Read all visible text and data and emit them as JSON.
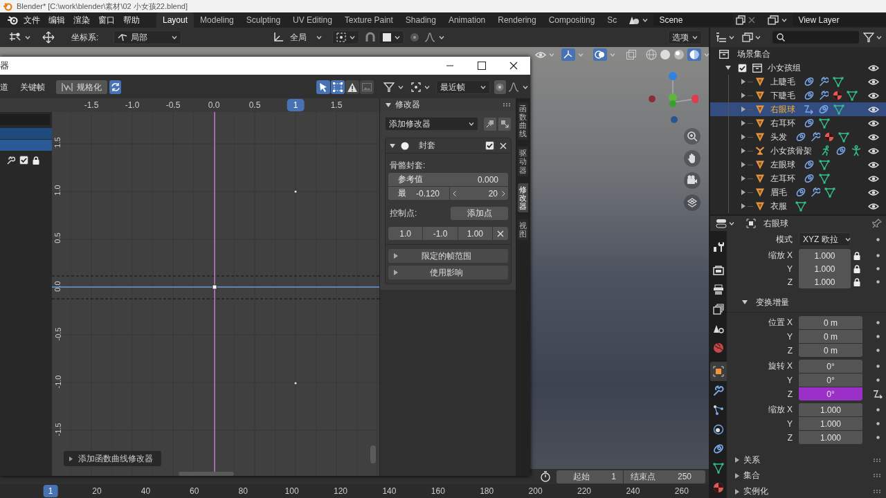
{
  "title_bar": {
    "title": "Blender* [C:\\work\\blender\\素材\\02 小女孩22.blend]"
  },
  "menu": [
    "文件",
    "编辑",
    "渲染",
    "窗口",
    "帮助"
  ],
  "workspaces": [
    {
      "label": "Layout",
      "selected": true
    },
    {
      "label": "Modeling",
      "selected": false
    },
    {
      "label": "Sculpting",
      "selected": false
    },
    {
      "label": "UV Editing",
      "selected": false
    },
    {
      "label": "Texture Paint",
      "selected": false
    },
    {
      "label": "Shading",
      "selected": false
    },
    {
      "label": "Animation",
      "selected": false
    },
    {
      "label": "Rendering",
      "selected": false
    },
    {
      "label": "Compositing",
      "selected": false
    },
    {
      "label": "Sc",
      "selected": false
    }
  ],
  "scene": "Scene",
  "view_layer": "View Layer",
  "viewport_header": {
    "coordinate_label": "坐标系:",
    "orientation": "局部",
    "pivot_space": "全局",
    "options": "选项"
  },
  "graph_editor": {
    "title": "器",
    "menus": [
      "道",
      "关键帧"
    ],
    "normalize": {
      "label": "规格化",
      "on": false
    },
    "auto_normalize": {
      "on": true
    },
    "filters": [
      {
        "kind": "select",
        "on": true
      },
      {
        "kind": "box",
        "on": true
      },
      {
        "kind": "warning",
        "on": false
      },
      {
        "kind": "image",
        "on": false
      }
    ],
    "snap": "最近帧",
    "channel_toggle": {
      "checked": true
    },
    "x_ticks": [
      {
        "label": "-1.5",
        "selected": false
      },
      {
        "label": "-1.0",
        "selected": false
      },
      {
        "label": "-0.5",
        "selected": false
      },
      {
        "label": "0.0",
        "selected": false
      },
      {
        "label": "0.5",
        "selected": false
      },
      {
        "label": "1",
        "selected": true
      },
      {
        "label": "1.5",
        "selected": false
      }
    ],
    "y_ticks": [
      "1.5",
      "1.0",
      "0.5",
      "0.0",
      "-0.5",
      "-1.0",
      "-1.5"
    ],
    "add_modifier_hint": "添加函数曲线修改器",
    "sidebar": {
      "tabs": [
        {
          "label": "函数曲线",
          "selected": false
        },
        {
          "label": "驱动器",
          "selected": false
        },
        {
          "label": "修改器",
          "selected": true
        },
        {
          "label": "视图",
          "selected": false
        }
      ],
      "panel": {
        "title": "修改器",
        "expanded": true,
        "add_modifier": "添加修改器",
        "modifier": {
          "name": "封套",
          "expanded": true,
          "checked": true,
          "section": "骨骼封套:",
          "reference": {
            "label": "参考值",
            "value": "0.000"
          },
          "min": {
            "label": "最",
            "value": "-0.120"
          },
          "max": {
            "value": "20"
          },
          "control_points_label": "控制点:",
          "add_point": "添加点",
          "point": [
            "1.0",
            "-1.0",
            "1.00"
          ],
          "subpanels": [
            {
              "label": "限定的帧范围",
              "expanded": false
            },
            {
              "label": "使用影响",
              "expanded": false
            }
          ]
        }
      }
    }
  },
  "outliner": {
    "root": "场景集合",
    "collection": {
      "label": "小女孩组",
      "checked": true,
      "expanded": true,
      "children": [
        {
          "label": "上睫毛",
          "kind": "mesh",
          "selected": false,
          "expanded": false,
          "badges": [
            {
              "kind": "constraint"
            },
            {
              "kind": "modifier"
            },
            {
              "kind": "mesh_data"
            }
          ]
        },
        {
          "label": "下睫毛",
          "kind": "mesh",
          "selected": false,
          "expanded": false,
          "badges": [
            {
              "kind": "constraint"
            },
            {
              "kind": "modifier"
            },
            {
              "kind": "material"
            },
            {
              "kind": "mesh_data"
            }
          ]
        },
        {
          "label": "右眼球",
          "kind": "mesh",
          "selected": true,
          "expanded": false,
          "badges": [
            {
              "kind": "driver"
            },
            {
              "kind": "constraint"
            },
            {
              "kind": "mesh_data"
            }
          ]
        },
        {
          "label": "右耳环",
          "kind": "mesh",
          "selected": false,
          "expanded": false,
          "badges": [
            {
              "kind": "constraint"
            },
            {
              "kind": "mesh_data"
            }
          ]
        },
        {
          "label": "头发",
          "kind": "mesh",
          "selected": false,
          "expanded": false,
          "badges": [
            {
              "kind": "constraint"
            },
            {
              "kind": "modifier"
            },
            {
              "kind": "material"
            },
            {
              "kind": "mesh_data"
            }
          ]
        },
        {
          "label": "小女孩骨架",
          "kind": "armature",
          "selected": false,
          "expanded": false,
          "badges": [
            {
              "kind": "pose"
            },
            {
              "kind": "constraint"
            },
            {
              "kind": "armature_data"
            }
          ]
        },
        {
          "label": "左眼球",
          "kind": "mesh",
          "selected": false,
          "expanded": false,
          "badges": [
            {
              "kind": "constraint"
            },
            {
              "kind": "mesh_data"
            }
          ]
        },
        {
          "label": "左耳环",
          "kind": "mesh",
          "selected": false,
          "expanded": false,
          "badges": [
            {
              "kind": "constraint"
            },
            {
              "kind": "mesh_data"
            }
          ]
        },
        {
          "label": "眉毛",
          "kind": "mesh",
          "selected": false,
          "expanded": false,
          "badges": [
            {
              "kind": "constraint"
            },
            {
              "kind": "modifier"
            },
            {
              "kind": "mesh_data"
            }
          ]
        },
        {
          "label": "衣服",
          "kind": "mesh",
          "selected": false,
          "expanded": false,
          "badges": [
            {
              "kind": "mesh_data"
            }
          ]
        }
      ]
    }
  },
  "properties": {
    "object_name": "右眼球",
    "tabs": [
      {
        "kind": "tool",
        "selected": false
      },
      {
        "kind": "render",
        "selected": false
      },
      {
        "kind": "output",
        "selected": false
      },
      {
        "kind": "view_layer",
        "selected": false
      },
      {
        "kind": "scene",
        "selected": false
      },
      {
        "kind": "world",
        "selected": false
      },
      {
        "kind": "object",
        "selected": true
      },
      {
        "kind": "modifier",
        "selected": false
      },
      {
        "kind": "particles",
        "selected": false
      },
      {
        "kind": "physics",
        "selected": false
      },
      {
        "kind": "constraints",
        "selected": false
      },
      {
        "kind": "data",
        "selected": false
      },
      {
        "kind": "material",
        "selected": false
      }
    ],
    "rotation_mode": {
      "label": "模式",
      "value": "XYZ 欧拉"
    },
    "scale": [
      {
        "label": "缩放 X",
        "value": "1.000"
      },
      {
        "label": "Y",
        "value": "1.000"
      },
      {
        "label": "Z",
        "value": "1.000"
      }
    ],
    "delta": {
      "label": "变换增量",
      "expanded": true,
      "groups": [
        {
          "rows": [
            {
              "label": "位置 X",
              "value": "0 m",
              "driven": false
            },
            {
              "label": "Y",
              "value": "0 m",
              "driven": false
            },
            {
              "label": "Z",
              "value": "0 m",
              "driven": false
            }
          ]
        },
        {
          "rows": [
            {
              "label": "旋转 X",
              "value": "0°",
              "driven": false
            },
            {
              "label": "Y",
              "value": "0°",
              "driven": false
            },
            {
              "label": "Z",
              "value": "0°",
              "driven": true
            }
          ]
        },
        {
          "rows": [
            {
              "label": "缩放 X",
              "value": "1.000",
              "driven": false
            },
            {
              "label": "Y",
              "value": "1.000",
              "driven": false
            },
            {
              "label": "Z",
              "value": "1.000",
              "driven": false
            }
          ]
        }
      ]
    },
    "panels": [
      {
        "label": "关系",
        "expanded": false
      },
      {
        "label": "集合",
        "expanded": false
      },
      {
        "label": "实例化",
        "expanded": false
      }
    ]
  },
  "timeline": {
    "start": {
      "label": "起始",
      "value": "1"
    },
    "end": {
      "label": "结束点",
      "value": "250"
    },
    "ruler": [
      {
        "label": "1",
        "selected": true
      },
      {
        "label": "20",
        "selected": false
      },
      {
        "label": "40",
        "selected": false
      },
      {
        "label": "60",
        "selected": false
      },
      {
        "label": "80",
        "selected": false
      },
      {
        "label": "100",
        "selected": false
      },
      {
        "label": "120",
        "selected": false
      },
      {
        "label": "140",
        "selected": false
      },
      {
        "label": "160",
        "selected": false
      },
      {
        "label": "180",
        "selected": false
      },
      {
        "label": "200",
        "selected": false
      },
      {
        "label": "220",
        "selected": false
      },
      {
        "label": "240",
        "selected": false
      },
      {
        "label": "260",
        "selected": false
      }
    ]
  }
}
